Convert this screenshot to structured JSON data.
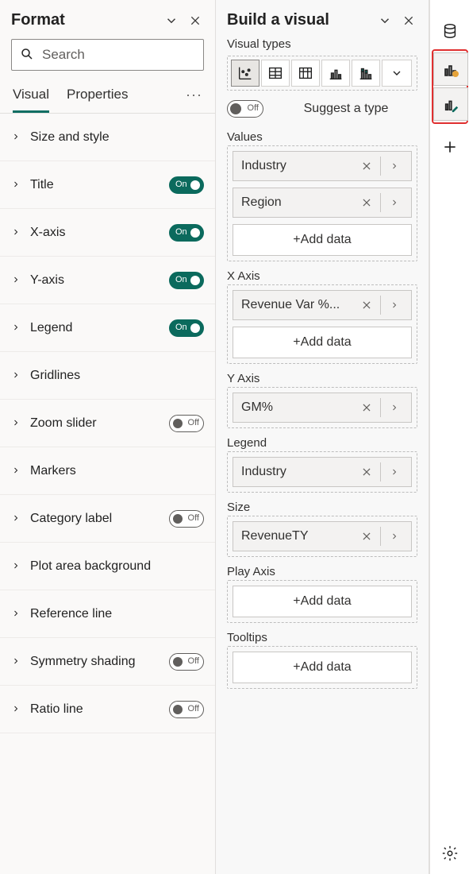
{
  "format": {
    "title": "Format",
    "search_placeholder": "Search",
    "tabs": {
      "visual": "Visual",
      "properties": "Properties"
    },
    "toggle_on": "On",
    "toggle_off": "Off",
    "rows": [
      {
        "label": "Size and style",
        "toggle": null
      },
      {
        "label": "Title",
        "toggle": "on"
      },
      {
        "label": "X-axis",
        "toggle": "on"
      },
      {
        "label": "Y-axis",
        "toggle": "on"
      },
      {
        "label": "Legend",
        "toggle": "on"
      },
      {
        "label": "Gridlines",
        "toggle": null
      },
      {
        "label": "Zoom slider",
        "toggle": "off"
      },
      {
        "label": "Markers",
        "toggle": null
      },
      {
        "label": "Category label",
        "toggle": "off"
      },
      {
        "label": "Plot area background",
        "toggle": null
      },
      {
        "label": "Reference line",
        "toggle": null
      },
      {
        "label": "Symmetry shading",
        "toggle": "off"
      },
      {
        "label": "Ratio line",
        "toggle": "off"
      }
    ]
  },
  "build": {
    "title": "Build a visual",
    "visual_types_label": "Visual types",
    "suggest_label": "Suggest a type",
    "suggest_state": "Off",
    "add_data": "+Add data",
    "wells": {
      "values": {
        "label": "Values",
        "chips": [
          "Industry",
          "Region"
        ],
        "add": true
      },
      "xaxis": {
        "label": "X Axis",
        "chips": [
          "Revenue Var %..."
        ],
        "add": true
      },
      "yaxis": {
        "label": "Y Axis",
        "chips": [
          "GM%"
        ],
        "add": false
      },
      "legend": {
        "label": "Legend",
        "chips": [
          "Industry"
        ],
        "add": false
      },
      "size": {
        "label": "Size",
        "chips": [
          "RevenueTY"
        ],
        "add": false
      },
      "playaxis": {
        "label": "Play Axis",
        "chips": [],
        "add": true
      },
      "tooltips": {
        "label": "Tooltips",
        "chips": [],
        "add": true
      }
    }
  }
}
